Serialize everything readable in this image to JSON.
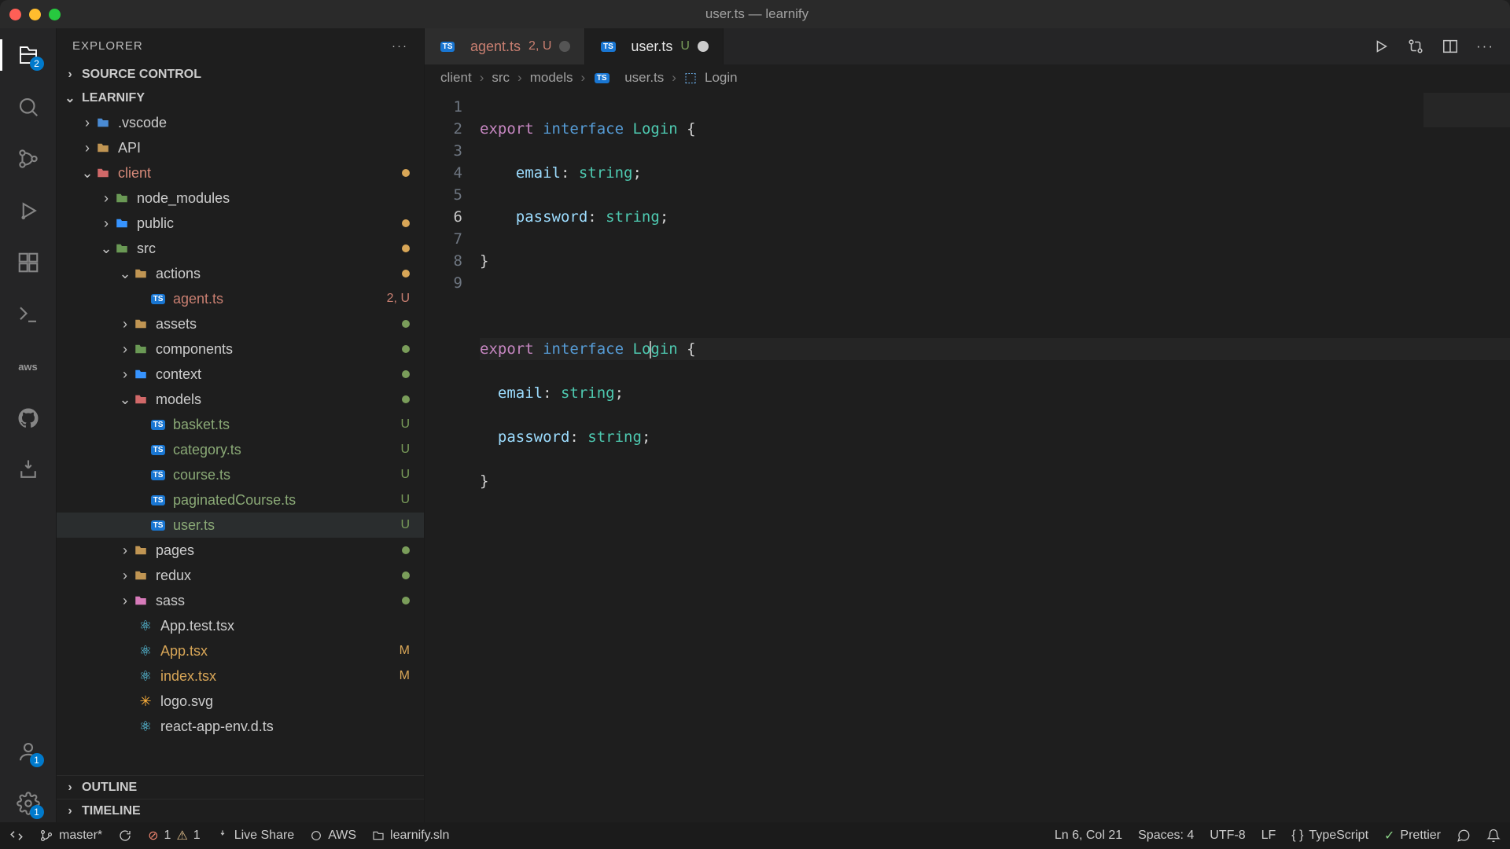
{
  "titlebar": {
    "title": "user.ts — learnify"
  },
  "explorer": {
    "title": "EXPLORER",
    "source_control": "SOURCE CONTROL",
    "project": "LEARNIFY",
    "outline": "OUTLINE",
    "timeline": "TIMELINE"
  },
  "tree": {
    "vscode": ".vscode",
    "api": "API",
    "client": "client",
    "node_modules": "node_modules",
    "public": "public",
    "src": "src",
    "actions": "actions",
    "agent_ts": "agent.ts",
    "agent_badge": "2, U",
    "assets": "assets",
    "components": "components",
    "context": "context",
    "models": "models",
    "basket_ts": "basket.ts",
    "category_ts": "category.ts",
    "course_ts": "course.ts",
    "paginated_ts": "paginatedCourse.ts",
    "user_ts": "user.ts",
    "pages": "pages",
    "redux": "redux",
    "sass": "sass",
    "app_test": "App.test.tsx",
    "app_tsx": "App.tsx",
    "index_tsx": "index.tsx",
    "logo_svg": "logo.svg",
    "react_env": "react-app-env.d.ts",
    "u_badge": "U",
    "m_badge": "M"
  },
  "tabs": {
    "agent": "agent.ts",
    "agent_badge": "2, U",
    "user": "user.ts",
    "user_u": "U"
  },
  "breadcrumbs": {
    "client": "client",
    "src": "src",
    "models": "models",
    "user_ts": "user.ts",
    "login": "Login"
  },
  "code": {
    "l1_export": "export",
    "l1_interface": "interface",
    "l1_name": "Login",
    "l1_brace": " {",
    "l2_prop": "email",
    "l2_colon": ": ",
    "l2_type": "string",
    "l2_semi": ";",
    "l3_prop": "password",
    "l3_colon": ": ",
    "l3_type": "string",
    "l3_semi": ";",
    "l4": "}",
    "l6_export": "export",
    "l6_interface": "interface",
    "l6_name_a": "Lo",
    "l6_name_b": "gin",
    "l6_brace": " {",
    "l7_prop": "email",
    "l7_colon": ": ",
    "l7_type": "string",
    "l7_semi": ";",
    "l8_prop": "password",
    "l8_colon": ": ",
    "l8_type": "string",
    "l8_semi": ";",
    "l9": "}",
    "lines": [
      "1",
      "2",
      "3",
      "4",
      "5",
      "6",
      "7",
      "8",
      "9"
    ]
  },
  "status": {
    "branch": "master*",
    "errors": "1",
    "warnings": "1",
    "live_share": "Live Share",
    "aws": "AWS",
    "sln": "learnify.sln",
    "position": "Ln 6, Col 21",
    "spaces": "Spaces: 4",
    "encoding": "UTF-8",
    "eol": "LF",
    "lang": "TypeScript",
    "prettier": "Prettier"
  },
  "activity": {
    "explorer_badge": "2",
    "account_badge": "1",
    "settings_badge": "1"
  }
}
